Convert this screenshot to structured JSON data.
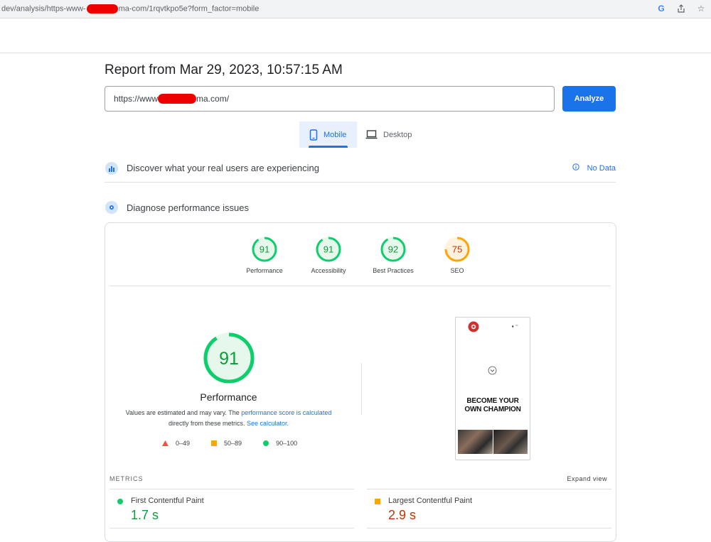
{
  "browser": {
    "url_prefix": "dev/analysis/https-www-",
    "url_suffix": "ma-com/1rqvtkpo5e?form_factor=mobile"
  },
  "report": {
    "title": "Report from Mar 29, 2023, 10:57:15 AM",
    "url_prefix": "https://www",
    "url_suffix": "ma.com/",
    "analyze_label": "Analyze"
  },
  "tabs": [
    {
      "label": "Mobile",
      "active": true
    },
    {
      "label": "Desktop",
      "active": false
    }
  ],
  "real_users": {
    "text": "Discover what your real users are experiencing",
    "no_data": "No Data"
  },
  "diagnose": {
    "text": "Diagnose performance issues"
  },
  "scores": [
    {
      "label": "Performance",
      "value": 91,
      "color": "#0cce6b"
    },
    {
      "label": "Accessibility",
      "value": 91,
      "color": "#0cce6b"
    },
    {
      "label": "Best Practices",
      "value": 92,
      "color": "#0cce6b"
    },
    {
      "label": "SEO",
      "value": 75,
      "color": "#ffa400"
    }
  ],
  "performance": {
    "score": 91,
    "title": "Performance",
    "explain_1": "Values are estimated and may vary. The ",
    "explain_link1": "performance score is calculated",
    "explain_2": " directly from these metrics. ",
    "explain_link2": "See calculator."
  },
  "legend": [
    {
      "range": "0–49",
      "color": "#ff4e42",
      "shape": "triangle"
    },
    {
      "range": "50–89",
      "color": "#ffa400",
      "shape": "square"
    },
    {
      "range": "90–100",
      "color": "#0cce6b",
      "shape": "circle"
    }
  ],
  "screenshot": {
    "headline_line1": "BECOME YOUR",
    "headline_line2": "OWN CHAMPION"
  },
  "metrics": {
    "label": "METRICS",
    "expand": "Expand view",
    "items": [
      {
        "name": "First Contentful Paint",
        "value": "1.7 s",
        "color": "#0c9d3a",
        "status": "good"
      },
      {
        "name": "Largest Contentful Paint",
        "value": "2.9 s",
        "color": "#c33300",
        "status": "average"
      }
    ]
  }
}
